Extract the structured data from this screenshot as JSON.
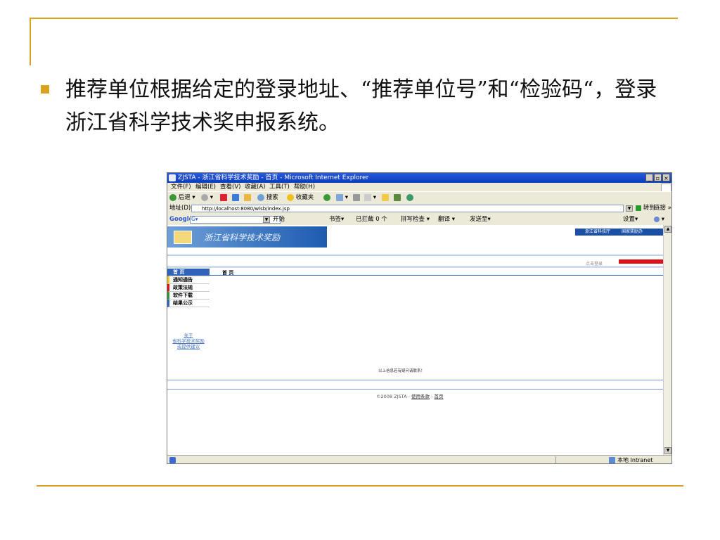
{
  "bullet": {
    "text": "推荐单位根据给定的登录地址、“推荐单位号”和“检验码“，登录浙江省科学技术奖申报系统。"
  },
  "browser": {
    "title": "ZJSTA - 浙江省科学技术奖励 - 首页 - Microsoft Internet Explorer",
    "window_buttons": [
      "_",
      "▫",
      "×"
    ],
    "menu": [
      "文件(F)",
      "编辑(E)",
      "查看(V)",
      "收藏(A)",
      "工具(T)",
      "帮助(H)"
    ],
    "toolbar": {
      "back": "后退",
      "search": "搜索",
      "favorites": "收藏夹"
    },
    "address": {
      "label": "地址(D)",
      "url": "http://localhost:8080/wlsb/index.jsp",
      "go": "转到",
      "links": "链接 »"
    },
    "google_bar": {
      "logo": "Google",
      "g_button": "G▾",
      "start": "开始",
      "bookmarks": "书签▾",
      "blocked": "已拦截 0 个",
      "spellcheck": "拼写检查 ▾",
      "translate": "翻译 ▾",
      "send_to": "发送至▾",
      "settings": "设置▾"
    },
    "status": {
      "zone": "本地 Intranet"
    }
  },
  "page": {
    "site_title": "浙江省科学技术奖励",
    "top_links": [
      "浙江省科技厅",
      "国家奖励办"
    ],
    "login_link": "点击登录",
    "sidebar_items": [
      "首 页",
      "通知通告",
      "政策法规",
      "软件下载",
      "结果公示"
    ],
    "sidebar_about": [
      "关于",
      "省科学技术奖励",
      "或提供建议"
    ],
    "breadcrumb": "首 页",
    "note": "以上信息若有疑问请联系！",
    "footer": {
      "copyright": "©2008 ZJSTA - ",
      "terms": "使用条款",
      "sep": " - ",
      "home": "首页"
    }
  },
  "colors": {
    "accent_gold": "#d9a321",
    "ie_title_blue": "#0a3cc0",
    "site_blue": "#2f64b8",
    "red_bar": "#e01018"
  }
}
